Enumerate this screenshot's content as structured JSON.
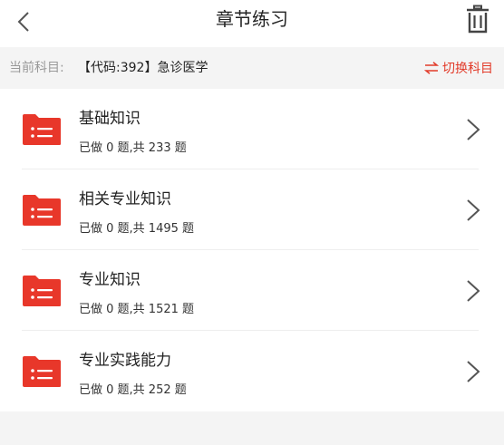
{
  "header": {
    "title": "章节练习",
    "back_icon": "chevron-left-icon",
    "trash_icon": "trash-icon"
  },
  "subject": {
    "label": "当前科目:",
    "value": "【代码:392】急诊医学",
    "switch_label": "切换科目",
    "switch_icon": "swap-icon"
  },
  "colors": {
    "accent": "#e23b2a",
    "folder": "#e8372a"
  },
  "chapters": [
    {
      "title": "基础知识",
      "progress": "已做 0 题,共 233 题"
    },
    {
      "title": "相关专业知识",
      "progress": "已做 0 题,共 1495 题"
    },
    {
      "title": "专业知识",
      "progress": "已做 0 题,共 1521 题"
    },
    {
      "title": "专业实践能力",
      "progress": "已做 0 题,共 252 题"
    }
  ]
}
